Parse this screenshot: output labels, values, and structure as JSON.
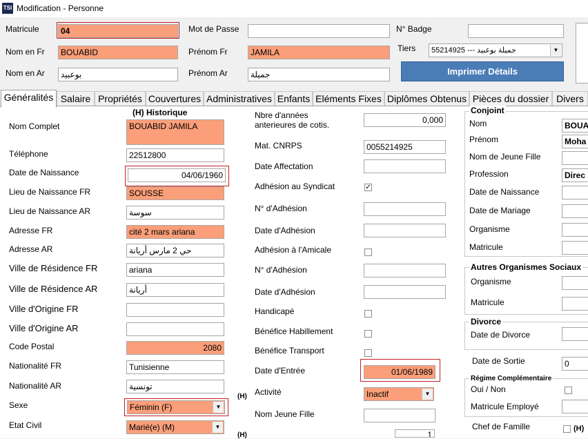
{
  "window": {
    "title": "Modification - Personne",
    "icon": "app-logo-icon"
  },
  "header": {
    "matricule_label": "Matricule",
    "matricule_value": "04",
    "mot_de_passe_label": "Mot de Passe",
    "mot_de_passe_value": "",
    "badge_label": "N° Badge",
    "badge_value": "",
    "nom_fr_label": "Nom en Fr",
    "nom_fr_value": "BOUABID",
    "prenom_fr_label": "Prénom Fr",
    "prenom_fr_value": "JAMILA",
    "tiers_label": "Tiers",
    "tiers_value": "55214925 --- جميلة بوعبيد",
    "nom_ar_label": "Nom en Ar",
    "nom_ar_value": "بوعبيد",
    "prenom_ar_label": "Prénom Ar",
    "prenom_ar_value": "جميلة",
    "print_button": "Imprimer Détails"
  },
  "tabs": [
    "Généralités",
    "Salaire",
    "Propriétés",
    "Couvertures",
    "Administratives",
    "Enfants",
    "Eléments Fixes",
    "Diplômes Obtenus",
    "Pièces du dossier",
    "Divers"
  ],
  "left": {
    "historique": "(H) Historique",
    "nom_complet_label": "Nom Complet",
    "nom_complet_value": "BOUABID JAMILA",
    "telephone_label": "Téléphone",
    "telephone_value": "22512800",
    "naissance_label": "Date de Naissance",
    "naissance_value": "04/06/1960",
    "lieu_fr_label": "Lieu de Naissance FR",
    "lieu_fr_value": "SOUSSE",
    "lieu_ar_label": "Lieu de Naissance AR",
    "lieu_ar_value": "سوسة",
    "adresse_fr_label": "Adresse FR",
    "adresse_fr_value": "cité 2 mars ariana",
    "adresse_ar_label": "Adresse AR",
    "adresse_ar_value": "حي 2 مارس أريانة",
    "ville_res_fr_label": "Ville de Résidence FR",
    "ville_res_fr_value": "ariana",
    "ville_res_ar_label": "Ville de Résidence AR",
    "ville_res_ar_value": "أريانة",
    "ville_orig_fr_label": "Ville d'Origine FR",
    "ville_orig_fr_value": "",
    "ville_orig_ar_label": "Ville d'Origine AR",
    "ville_orig_ar_value": "",
    "code_postal_label": "Code Postal",
    "code_postal_value": "2080",
    "nat_fr_label": "Nationalité FR",
    "nat_fr_value": "Tunisienne",
    "nat_ar_label": "Nationalité AR",
    "nat_ar_value": "تونسية",
    "sexe_label": "Sexe",
    "sexe_value": "Féminin (F)",
    "etat_civil_label": "Etat Civil",
    "etat_civil_value": "Marié(e) (M)",
    "h_marker": "(H)"
  },
  "middle": {
    "annees_label_1": "Nbre d'années",
    "annees_label_2": "anterieures de cotis.",
    "annees_value": "0,000",
    "cnrps_label": "Mat. CNRPS",
    "cnrps_value": "0055214925",
    "affectation_label": "Date Affectation",
    "affectation_value": "",
    "syndicat_label": "Adhésion au Syndicat",
    "syndicat_checked": "✓",
    "adhesion1_label": "N° d'Adhésion",
    "adhesion1_value": "",
    "date_adhesion1_label": "Date d'Adhésion",
    "date_adhesion1_value": "",
    "amicale_label": "Adhésion à l'Amicale",
    "adhesion2_label": "N° d'Adhésion",
    "adhesion2_value": "",
    "date_adhesion2_label": "Date d'Adhésion",
    "date_adhesion2_value": "",
    "handicape_label": "Handicapé",
    "habillement_label": "Bénéfice Habillement",
    "transport_label": "Bénéfice Transport",
    "entree_label": "Date d'Entrée",
    "entree_value": "01/06/1989",
    "activite_label": "Activité",
    "activite_value": "Inactif",
    "jeune_fille_label": "Nom Jeune Fille",
    "jeune_fille_value": "",
    "bottom_value": "1",
    "h_marker": "(H)"
  },
  "right": {
    "conjoint_title": "Conjoint",
    "nom_label": "Nom",
    "nom_value": "BOUA",
    "prenom_label": "Prénom",
    "prenom_value": "Moha",
    "jeune_fille_label": "Nom de Jeune Fille",
    "jeune_fille_value": "",
    "profession_label": "Profession",
    "profession_value": "Direc",
    "naissance_label": "Date de Naissance",
    "naissance_value": "",
    "mariage_label": "Date de Mariage",
    "mariage_value": "",
    "organisme_label": "Organisme",
    "organisme_value": "",
    "matricule_label": "Matricule",
    "matricule_value": "",
    "autres_title": "Autres Organismes Sociaux",
    "autres_organisme_label": "Organisme",
    "autres_organisme_value": "",
    "autres_matricule_label": "Matricule",
    "autres_matricule_value": "",
    "divorce_title": "Divorce",
    "divorce_label": "Date de Divorce",
    "divorce_value": "",
    "sortie_label": "Date de Sortie",
    "sortie_value": "0",
    "regime_title": "Régime Complémentaire",
    "oui_non_label": "Oui / Non",
    "matricule_employe_label": "Matricule Employé",
    "matricule_employe_value": "",
    "chef_famille_label": "Chef de Famille",
    "h_marker": "(H)"
  }
}
